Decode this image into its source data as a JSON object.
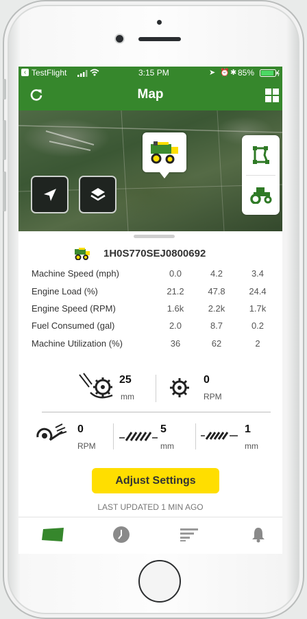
{
  "status_bar": {
    "carrier": "TestFlight",
    "time": "3:15 PM",
    "battery": "85%"
  },
  "nav": {
    "title": "Map",
    "left_icon": "refresh-icon",
    "right_icon": "grid-icon"
  },
  "map": {
    "buttons": [
      "locate-icon",
      "layers-icon",
      "field-boundary-icon",
      "tractor-icon"
    ],
    "pin_icon": "combine-icon"
  },
  "machine": {
    "id": "1H0S770SEJ0800692"
  },
  "stats": [
    {
      "label": "Machine Speed (mph)",
      "values": [
        "0.0",
        "4.2",
        "3.4"
      ]
    },
    {
      "label": "Engine Load (%)",
      "values": [
        "21.2",
        "47.8",
        "24.4"
      ]
    },
    {
      "label": "Engine Speed (RPM)",
      "values": [
        "1.6k",
        "2.2k",
        "1.7k"
      ]
    },
    {
      "label": "Fuel Consumed (gal)",
      "values": [
        "2.0",
        "8.7",
        "0.2"
      ]
    },
    {
      "label": "Machine Utilization (%)",
      "values": [
        "36",
        "62",
        "2"
      ]
    }
  ],
  "settings": {
    "concave": {
      "value": "25",
      "unit": "mm"
    },
    "rotor": {
      "value": "0",
      "unit": "RPM"
    },
    "fan": {
      "value": "0",
      "unit": "RPM"
    },
    "upper_sieve": {
      "value": "5",
      "unit": "mm"
    },
    "lower_sieve": {
      "value": "1",
      "unit": "mm"
    }
  },
  "actions": {
    "adjust_label": "Adjust Settings",
    "last_updated": "LAST UPDATED 1 MIN AGO"
  },
  "tabs": [
    "map-tab-icon",
    "history-tab-icon",
    "reports-tab-icon",
    "alerts-tab-icon"
  ],
  "colors": {
    "brand_green": "#36872c",
    "accent_yellow": "#ffde00"
  }
}
